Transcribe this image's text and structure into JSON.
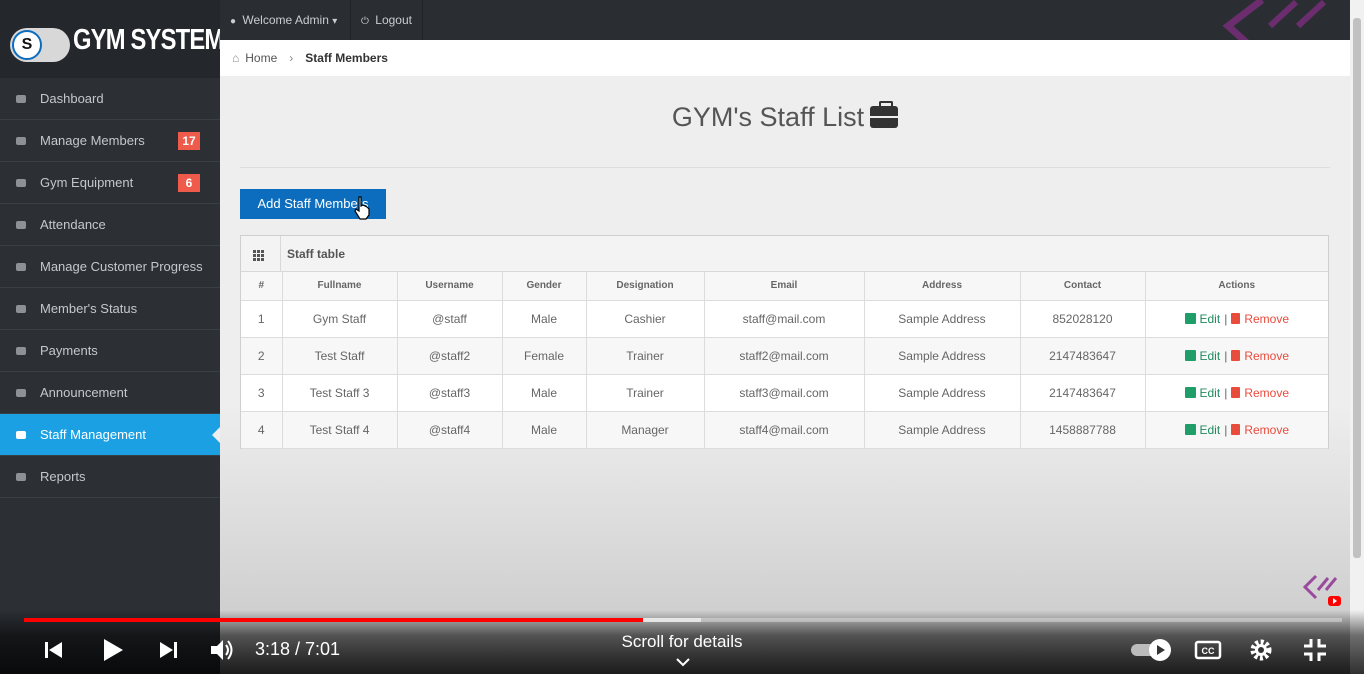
{
  "app": {
    "logo_text": "GYM SYSTEM",
    "logo_toggle_letter": "S"
  },
  "topbar": {
    "welcome_label": "Welcome Admin",
    "logout_label": "Logout"
  },
  "sidebar": {
    "items": [
      {
        "label": "Dashboard",
        "icon": "dashboard-icon"
      },
      {
        "label": "Manage Members",
        "icon": "users-icon",
        "badge": "17"
      },
      {
        "label": "Gym Equipment",
        "icon": "dumbbell-icon",
        "badge": "6"
      },
      {
        "label": "Attendance",
        "icon": "calendar-icon"
      },
      {
        "label": "Manage Customer Progress",
        "icon": "list-icon"
      },
      {
        "label": "Member's Status",
        "icon": "eye-icon"
      },
      {
        "label": "Payments",
        "icon": "hand-money-icon"
      },
      {
        "label": "Announcement",
        "icon": "megaphone-icon"
      },
      {
        "label": "Staff Management",
        "icon": "briefcase-icon",
        "active": true
      },
      {
        "label": "Reports",
        "icon": "file-icon"
      }
    ]
  },
  "breadcrumb": {
    "home": "Home",
    "current": "Staff Members"
  },
  "page": {
    "title": "GYM's Staff List",
    "add_button": "Add Staff Members"
  },
  "table": {
    "heading": "Staff table",
    "columns": [
      "#",
      "Fullname",
      "Username",
      "Gender",
      "Designation",
      "Email",
      "Address",
      "Contact",
      "Actions"
    ],
    "rows": [
      [
        "1",
        "Gym Staff",
        "@staff",
        "Male",
        "Cashier",
        "staff@mail.com",
        "Sample Address",
        "852028120"
      ],
      [
        "2",
        "Test Staff",
        "@staff2",
        "Female",
        "Trainer",
        "staff2@mail.com",
        "Sample Address",
        "2147483647"
      ],
      [
        "3",
        "Test Staff 3",
        "@staff3",
        "Male",
        "Trainer",
        "staff3@mail.com",
        "Sample Address",
        "2147483647"
      ],
      [
        "4",
        "Test Staff 4",
        "@staff4",
        "Male",
        "Manager",
        "staff4@mail.com",
        "Sample Address",
        "1458887788"
      ]
    ],
    "edit_label": "Edit",
    "separator": "|",
    "remove_label": "Remove"
  },
  "video": {
    "time": "3:18 / 7:01",
    "scroll_hint": "Scroll for details",
    "played_fraction": 0.47,
    "buffered_fraction": 0.514
  },
  "colors": {
    "accent": "#1aa0e3",
    "button": "#0c6dbf",
    "badge": "#ef5b4b",
    "edit": "#1f8b5e",
    "remove": "#e84c3d",
    "progress": "#ff0000"
  }
}
